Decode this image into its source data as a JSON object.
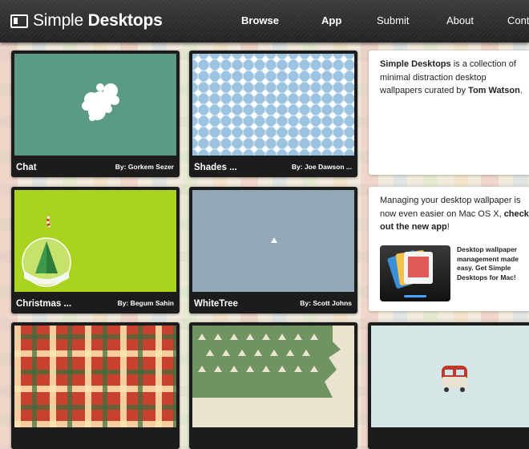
{
  "header": {
    "logo_light": "Simple",
    "logo_bold": "Desktops",
    "nav": {
      "browse": "Browse",
      "app": "App",
      "submit": "Submit",
      "about": "About",
      "contact": "Conta"
    }
  },
  "cards": [
    {
      "title": "Chat",
      "author": "By: Gorkem Sezer"
    },
    {
      "title": "Shades ...",
      "author": "By: Joe Dawson ..."
    },
    {
      "title": "Christmas ...",
      "author": "By: Begum Sahin"
    },
    {
      "title": "WhiteTree",
      "author": "By: Scott Johns"
    }
  ],
  "sidebar": {
    "about_bold": "Simple Desktops",
    "about_text": " is a collection of minimal distraction desktop wallpapers curated by ",
    "about_author": "Tom Watson",
    "about_end": ".",
    "app_text": "Managing your desktop wallpaper is now even easier on Mac OS X, ",
    "app_link": "check out the new app",
    "app_end": "!",
    "promo": "Desktop wallpaper management made easy. Get Simple Desktops for Mac!"
  },
  "colors": {
    "header_bg": "#2a2a2a",
    "card_bg": "#1c1c1c",
    "chat_bg": "#5b9a86",
    "xmas_bg": "#a9d31e",
    "whitetree_bg": "#93a8b6"
  }
}
